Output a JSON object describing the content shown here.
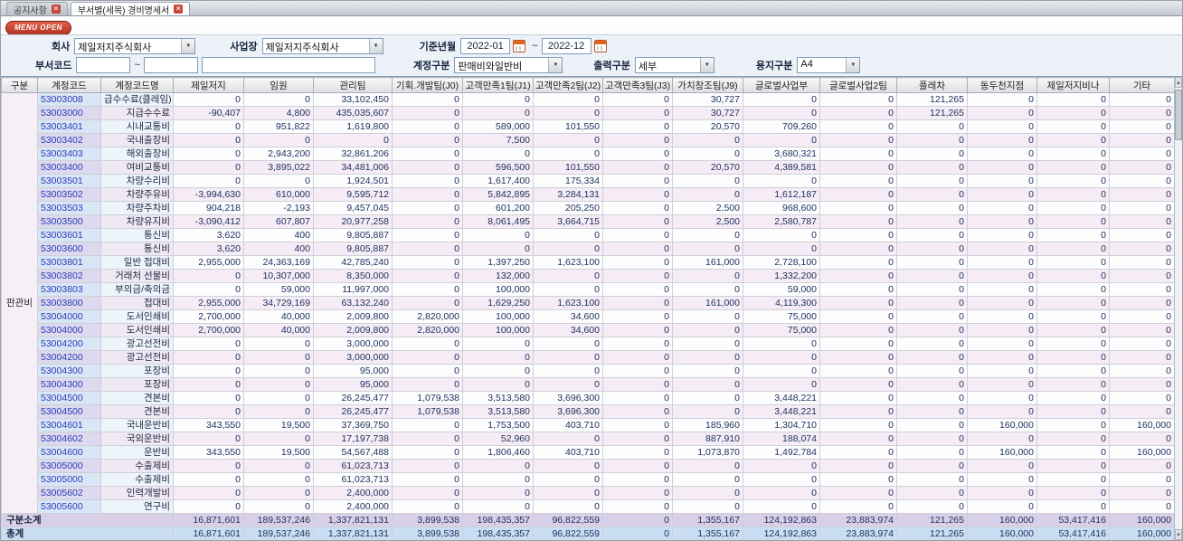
{
  "tabs": [
    {
      "label": "공지사항"
    },
    {
      "label": "부서별(세목) 경비명세서"
    }
  ],
  "menu_open_label": "MENU OPEN",
  "filters": {
    "company_label": "회사",
    "company_value": "제일저지주식회사",
    "site_label": "사업장",
    "site_value": "제일저지주식회사",
    "period_label": "기준년월",
    "period_from": "2022-01",
    "period_to": "2022-12",
    "tilde": "~",
    "dept_code_label": "부서코드",
    "dept_from": "",
    "dept_to": "",
    "dept_name": "",
    "account_label": "계정구분",
    "account_value": "판매비와일반비",
    "output_label": "출력구분",
    "output_value": "세부",
    "paper_label": "용지구분",
    "paper_value": "A4"
  },
  "table": {
    "group_label": "판관비",
    "columns": [
      "구분",
      "계정코드",
      "계정코드명",
      "제일저지",
      "임원",
      "관리팀",
      "기획.개발팀(J0)",
      "고객만족1팀(J1)",
      "고객만족2팀(J2)",
      "고객만족3팀(J3)",
      "가치창조팀(J9)",
      "글로벌사업부",
      "글로벌사업2팀",
      "플레차",
      "동두천지점",
      "제일저지비나",
      "기타"
    ],
    "rows": [
      {
        "code": "53003008",
        "name": "급수수료(클레임)",
        "values": [
          "0",
          "0",
          "33,102,450",
          "0",
          "0",
          "0",
          "0",
          "30,727",
          "0",
          "0",
          "121,265",
          "0",
          "0",
          "0"
        ]
      },
      {
        "code": "53003000",
        "name": "지급수수료",
        "values": [
          "-90,407",
          "4,800",
          "435,035,607",
          "0",
          "0",
          "0",
          "0",
          "30,727",
          "0",
          "0",
          "121,265",
          "0",
          "0",
          "0"
        ]
      },
      {
        "code": "53003401",
        "name": "시내교통비",
        "values": [
          "0",
          "951,822",
          "1,619,800",
          "0",
          "589,000",
          "101,550",
          "0",
          "20,570",
          "709,260",
          "0",
          "0",
          "0",
          "0",
          "0"
        ]
      },
      {
        "code": "53003402",
        "name": "국내출장비",
        "values": [
          "0",
          "0",
          "0",
          "0",
          "7,500",
          "0",
          "0",
          "0",
          "0",
          "0",
          "0",
          "0",
          "0",
          "0"
        ]
      },
      {
        "code": "53003403",
        "name": "해외출장비",
        "values": [
          "0",
          "2,943,200",
          "32,861,206",
          "0",
          "0",
          "0",
          "0",
          "0",
          "3,680,321",
          "0",
          "0",
          "0",
          "0",
          "0"
        ]
      },
      {
        "code": "53003400",
        "name": "여비교통비",
        "values": [
          "0",
          "3,895,022",
          "34,481,006",
          "0",
          "596,500",
          "101,550",
          "0",
          "20,570",
          "4,389,581",
          "0",
          "0",
          "0",
          "0",
          "0"
        ]
      },
      {
        "code": "53003501",
        "name": "차량수리비",
        "values": [
          "0",
          "0",
          "1,924,501",
          "0",
          "1,617,400",
          "175,334",
          "0",
          "0",
          "0",
          "0",
          "0",
          "0",
          "0",
          "0"
        ]
      },
      {
        "code": "53003502",
        "name": "차량주유비",
        "values": [
          "-3,994,630",
          "610,000",
          "9,595,712",
          "0",
          "5,842,895",
          "3,284,131",
          "0",
          "0",
          "1,612,187",
          "0",
          "0",
          "0",
          "0",
          "0"
        ]
      },
      {
        "code": "53003503",
        "name": "차량주차비",
        "values": [
          "904,218",
          "-2,193",
          "9,457,045",
          "0",
          "601,200",
          "205,250",
          "0",
          "2,500",
          "968,600",
          "0",
          "0",
          "0",
          "0",
          "0"
        ]
      },
      {
        "code": "53003500",
        "name": "차량유지비",
        "values": [
          "-3,090,412",
          "607,807",
          "20,977,258",
          "0",
          "8,061,495",
          "3,664,715",
          "0",
          "2,500",
          "2,580,787",
          "0",
          "0",
          "0",
          "0",
          "0"
        ]
      },
      {
        "code": "53003601",
        "name": "통신비",
        "values": [
          "3,620",
          "400",
          "9,805,887",
          "0",
          "0",
          "0",
          "0",
          "0",
          "0",
          "0",
          "0",
          "0",
          "0",
          "0"
        ]
      },
      {
        "code": "53003600",
        "name": "통신비",
        "values": [
          "3,620",
          "400",
          "9,805,887",
          "0",
          "0",
          "0",
          "0",
          "0",
          "0",
          "0",
          "0",
          "0",
          "0",
          "0"
        ]
      },
      {
        "code": "53003801",
        "name": "일반 접대비",
        "values": [
          "2,955,000",
          "24,363,169",
          "42,785,240",
          "0",
          "1,397,250",
          "1,623,100",
          "0",
          "161,000",
          "2,728,100",
          "0",
          "0",
          "0",
          "0",
          "0"
        ]
      },
      {
        "code": "53003802",
        "name": "거래처 선물비",
        "values": [
          "0",
          "10,307,000",
          "8,350,000",
          "0",
          "132,000",
          "0",
          "0",
          "0",
          "1,332,200",
          "0",
          "0",
          "0",
          "0",
          "0"
        ]
      },
      {
        "code": "53003803",
        "name": "부의금/축의금",
        "values": [
          "0",
          "59,000",
          "11,997,000",
          "0",
          "100,000",
          "0",
          "0",
          "0",
          "59,000",
          "0",
          "0",
          "0",
          "0",
          "0"
        ]
      },
      {
        "code": "53003800",
        "name": "접대비",
        "values": [
          "2,955,000",
          "34,729,169",
          "63,132,240",
          "0",
          "1,629,250",
          "1,623,100",
          "0",
          "161,000",
          "4,119,300",
          "0",
          "0",
          "0",
          "0",
          "0"
        ]
      },
      {
        "code": "53004000",
        "name": "도서인쇄비",
        "values": [
          "2,700,000",
          "40,000",
          "2,009,800",
          "2,820,000",
          "100,000",
          "34,600",
          "0",
          "0",
          "75,000",
          "0",
          "0",
          "0",
          "0",
          "0"
        ]
      },
      {
        "code": "53004000",
        "name": "도서인쇄비",
        "values": [
          "2,700,000",
          "40,000",
          "2,009,800",
          "2,820,000",
          "100,000",
          "34,600",
          "0",
          "0",
          "75,000",
          "0",
          "0",
          "0",
          "0",
          "0"
        ]
      },
      {
        "code": "53004200",
        "name": "광고선전비",
        "values": [
          "0",
          "0",
          "3,000,000",
          "0",
          "0",
          "0",
          "0",
          "0",
          "0",
          "0",
          "0",
          "0",
          "0",
          "0"
        ]
      },
      {
        "code": "53004200",
        "name": "광고선전비",
        "values": [
          "0",
          "0",
          "3,000,000",
          "0",
          "0",
          "0",
          "0",
          "0",
          "0",
          "0",
          "0",
          "0",
          "0",
          "0"
        ]
      },
      {
        "code": "53004300",
        "name": "포장비",
        "values": [
          "0",
          "0",
          "95,000",
          "0",
          "0",
          "0",
          "0",
          "0",
          "0",
          "0",
          "0",
          "0",
          "0",
          "0"
        ]
      },
      {
        "code": "53004300",
        "name": "포장비",
        "values": [
          "0",
          "0",
          "95,000",
          "0",
          "0",
          "0",
          "0",
          "0",
          "0",
          "0",
          "0",
          "0",
          "0",
          "0"
        ]
      },
      {
        "code": "53004500",
        "name": "견본비",
        "values": [
          "0",
          "0",
          "26,245,477",
          "1,079,538",
          "3,513,580",
          "3,696,300",
          "0",
          "0",
          "3,448,221",
          "0",
          "0",
          "0",
          "0",
          "0"
        ]
      },
      {
        "code": "53004500",
        "name": "견본비",
        "values": [
          "0",
          "0",
          "26,245,477",
          "1,079,538",
          "3,513,580",
          "3,696,300",
          "0",
          "0",
          "3,448,221",
          "0",
          "0",
          "0",
          "0",
          "0"
        ]
      },
      {
        "code": "53004601",
        "name": "국내운반비",
        "values": [
          "343,550",
          "19,500",
          "37,369,750",
          "0",
          "1,753,500",
          "403,710",
          "0",
          "185,960",
          "1,304,710",
          "0",
          "0",
          "160,000",
          "0",
          "160,000"
        ]
      },
      {
        "code": "53004602",
        "name": "국외운반비",
        "values": [
          "0",
          "0",
          "17,197,738",
          "0",
          "52,960",
          "0",
          "0",
          "887,910",
          "188,074",
          "0",
          "0",
          "0",
          "0",
          "0"
        ]
      },
      {
        "code": "53004600",
        "name": "운반비",
        "values": [
          "343,550",
          "19,500",
          "54,567,488",
          "0",
          "1,806,460",
          "403,710",
          "0",
          "1,073,870",
          "1,492,784",
          "0",
          "0",
          "160,000",
          "0",
          "160,000"
        ]
      },
      {
        "code": "53005000",
        "name": "수출제비",
        "values": [
          "0",
          "0",
          "61,023,713",
          "0",
          "0",
          "0",
          "0",
          "0",
          "0",
          "0",
          "0",
          "0",
          "0",
          "0"
        ]
      },
      {
        "code": "53005000",
        "name": "수출제비",
        "values": [
          "0",
          "0",
          "61,023,713",
          "0",
          "0",
          "0",
          "0",
          "0",
          "0",
          "0",
          "0",
          "0",
          "0",
          "0"
        ]
      },
      {
        "code": "53005602",
        "name": "인력개발비",
        "values": [
          "0",
          "0",
          "2,400,000",
          "0",
          "0",
          "0",
          "0",
          "0",
          "0",
          "0",
          "0",
          "0",
          "0",
          "0"
        ]
      },
      {
        "code": "53005600",
        "name": "연구비",
        "values": [
          "0",
          "0",
          "2,400,000",
          "0",
          "0",
          "0",
          "0",
          "0",
          "0",
          "0",
          "0",
          "0",
          "0",
          "0"
        ]
      }
    ],
    "subtotal": {
      "label": "구분소계",
      "values": [
        "16,871,601",
        "189,537,246",
        "1,337,821,131",
        "3,899,538",
        "198,435,357",
        "96,822,559",
        "0",
        "1,355,167",
        "124,192,863",
        "23,883,974",
        "121,265",
        "160,000",
        "53,417,416",
        "160,000"
      ]
    },
    "total": {
      "label": "총계",
      "values": [
        "16,871,601",
        "189,537,246",
        "1,337,821,131",
        "3,899,538",
        "198,435,357",
        "96,822,559",
        "0",
        "1,355,167",
        "124,192,863",
        "23,883,974",
        "121,265",
        "160,000",
        "53,417,416",
        "160,000"
      ]
    }
  },
  "colors": {
    "menu_button_red": "#b23323",
    "tab_close_red": "#c44638",
    "stripe_bg": "#f5ecf5",
    "subtotal_bg": "#d9d0e8",
    "total_bg": "#c9def2",
    "code_col_bg": "#d9e6f6",
    "code_text": "#2b3cb8",
    "number_text": "#1c2f5e"
  }
}
